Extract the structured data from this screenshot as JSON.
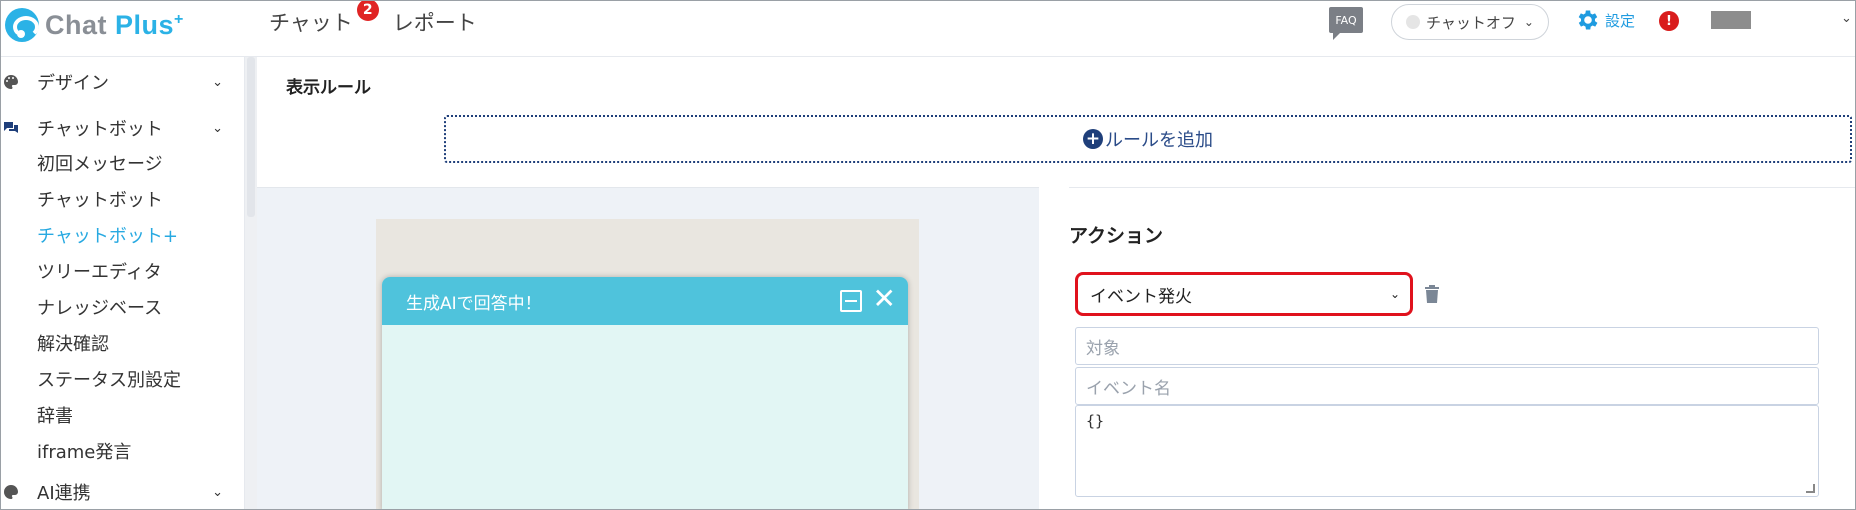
{
  "header": {
    "logo_text": "Chat ",
    "logo_text_accent": "Plus",
    "logo_sup": "+",
    "nav": [
      {
        "label": "チャット",
        "badge": "2"
      },
      {
        "label": "レポート"
      }
    ],
    "faq_label": "FAQ",
    "chat_status": "チャットオフ",
    "settings_label": "設定",
    "alert_symbol": "!"
  },
  "sidebar": {
    "sections": [
      {
        "label": "デザイン",
        "icon": "palette-icon"
      },
      {
        "label": "チャットボット",
        "icon": "chat-bubbles-icon"
      },
      {
        "label": "AI連携",
        "icon": "palette-icon"
      }
    ],
    "items": [
      {
        "label": "初回メッセージ",
        "active": false
      },
      {
        "label": "チャットボット",
        "active": false
      },
      {
        "label": "チャットボット+",
        "active": true
      },
      {
        "label": "ツリーエディタ",
        "active": false
      },
      {
        "label": "ナレッジベース",
        "active": false
      },
      {
        "label": "解決確認",
        "active": false
      },
      {
        "label": "ステータス別設定",
        "active": false
      },
      {
        "label": "辞書",
        "active": false
      },
      {
        "label": "iframe発言",
        "active": false
      }
    ]
  },
  "main": {
    "title": "表示ルール",
    "add_rule_label": "ルールを追加",
    "widget_title": "生成AIで回答中！",
    "action": {
      "label": "アクション",
      "selected": "イベント発火",
      "target_placeholder": "対象",
      "event_name_placeholder": "イベント名",
      "payload_value": "{}"
    }
  },
  "colors": {
    "accent": "#27a9e1",
    "widget_header": "#4fc3dc",
    "widget_body": "#e2f6f4",
    "highlight": "#e0121d",
    "badge": "#e02424"
  }
}
